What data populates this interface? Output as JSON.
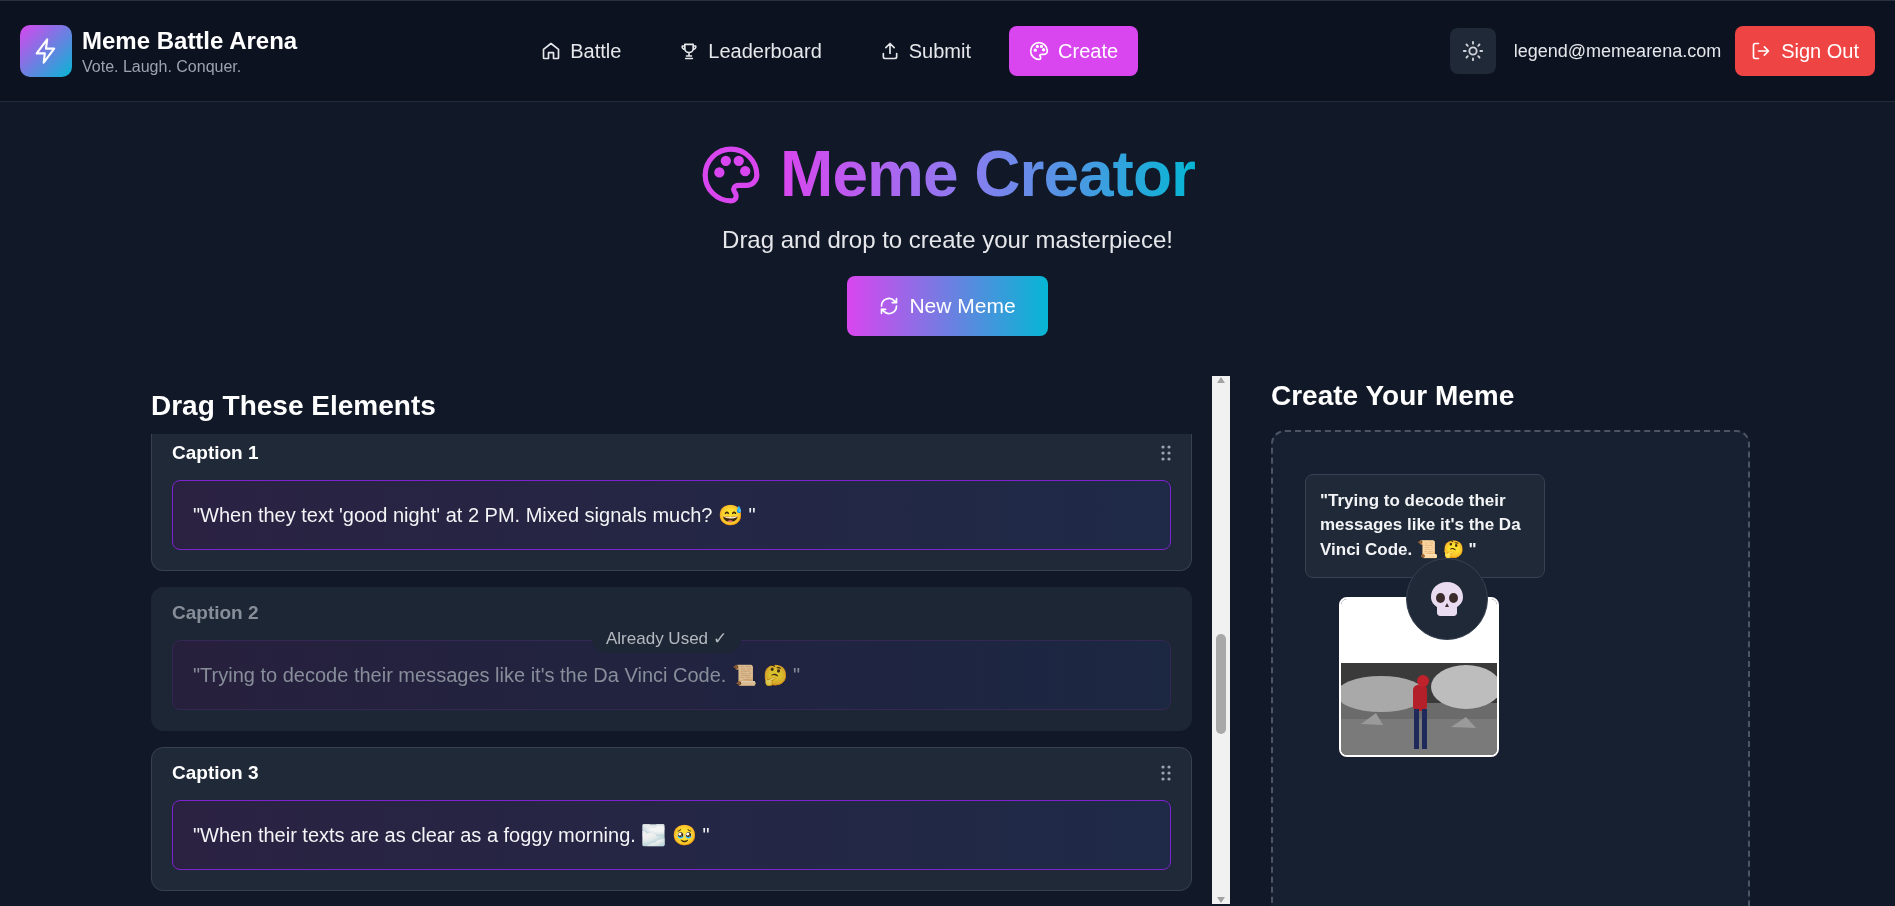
{
  "header": {
    "title": "Meme Battle Arena",
    "tagline": "Vote. Laugh. Conquer.",
    "nav": [
      {
        "label": "Battle",
        "kind": "home",
        "selected": false
      },
      {
        "label": "Leaderboard",
        "kind": "trophy",
        "selected": false
      },
      {
        "label": "Submit",
        "kind": "upload",
        "selected": false
      },
      {
        "label": "Create",
        "kind": "palette",
        "selected": true
      }
    ],
    "user_email": "legend@memearena.com",
    "sign_out": "Sign Out"
  },
  "hero": {
    "title": "Meme Creator",
    "subtitle": "Drag and drop to create your masterpiece!",
    "button": "New Meme"
  },
  "elements": {
    "heading": "Drag These Elements",
    "captions": [
      {
        "label": "Caption 1",
        "text": "\"When they text 'good night' at 2 PM. Mixed signals much? 😅 \"",
        "used": false
      },
      {
        "label": "Caption 2",
        "text": "\"Trying to decode their messages like it's the Da Vinci Code. 📜 🤔 \"",
        "used": true,
        "badge": "Already Used ✓"
      },
      {
        "label": "Caption 3",
        "text": "\"When their texts are as clear as a foggy morning. 🌫️ 🥹 \"",
        "used": false
      }
    ]
  },
  "canvas": {
    "heading": "Create Your Meme",
    "caption": "\"Trying to decode their messages like it's the Da Vinci Code. 📜 🤔 \"",
    "sticker": {
      "kind": "skull"
    }
  }
}
